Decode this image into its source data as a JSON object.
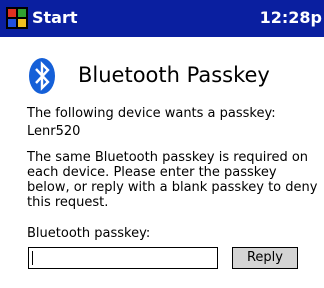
{
  "title_bar": {
    "start_label": "Start",
    "start_icon": "windows-flag-icon",
    "clock": "12:28p",
    "background": "#0a1fa0"
  },
  "dialog": {
    "logo_icon": "bluetooth-icon",
    "title": "Bluetooth Passkey",
    "prompt": "The following device wants a passkey:",
    "device_name": "Lenr520",
    "info": "The same Bluetooth passkey is required on each device. Please enter the passkey below, or reply with a blank passkey to deny this request.",
    "passkey_label": "Bluetooth passkey:",
    "passkey_value": "",
    "reply_label": "Reply"
  }
}
